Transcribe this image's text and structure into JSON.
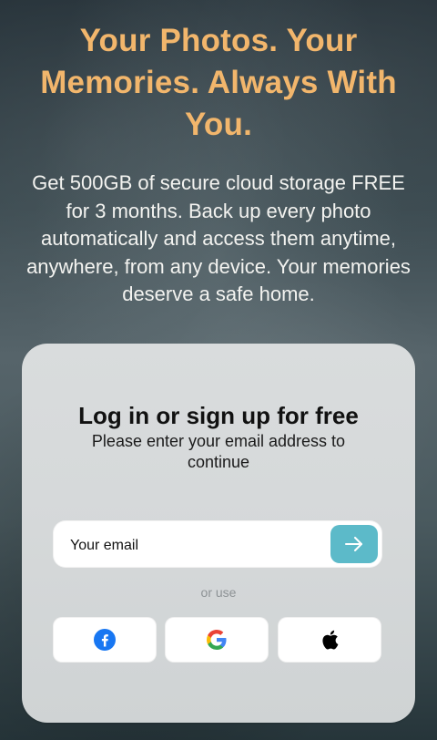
{
  "hero": {
    "title": "Your Photos. Your Memories. Always With You.",
    "description": "Get 500GB of secure cloud storage FREE for 3 months. Back up every photo automatically and access them anytime, anywhere, from any device. Your memories deserve a safe home."
  },
  "auth_card": {
    "title": "Log in or sign up for free",
    "subtitle": "Please enter your email address to continue",
    "email_placeholder": "Your email",
    "divider_text": "or use",
    "providers": [
      {
        "name": "facebook",
        "icon": "facebook-icon"
      },
      {
        "name": "google",
        "icon": "google-icon"
      },
      {
        "name": "apple",
        "icon": "apple-icon"
      }
    ]
  },
  "colors": {
    "title_accent": "#f2b66c",
    "submit_button": "#5cbac9",
    "facebook_blue": "#1877f2"
  }
}
